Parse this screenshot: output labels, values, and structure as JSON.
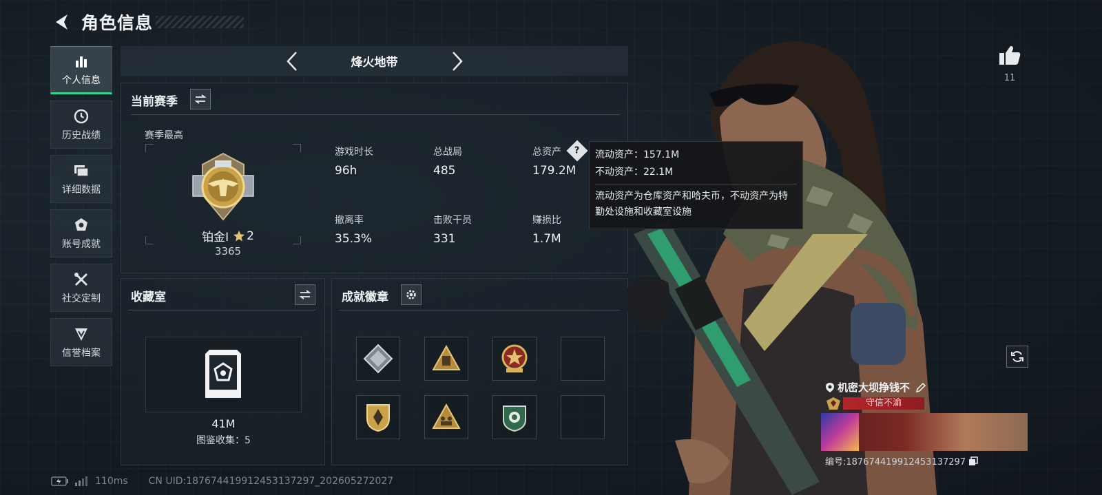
{
  "header": {
    "title": "角色信息"
  },
  "sidebar": {
    "items": [
      {
        "label": "个人信息",
        "icon": "bar-chart-icon",
        "active": true
      },
      {
        "label": "历史战绩",
        "icon": "history-icon"
      },
      {
        "label": "详细数据",
        "icon": "folder-icon"
      },
      {
        "label": "账号成就",
        "icon": "trophy-icon"
      },
      {
        "label": "社交定制",
        "icon": "tools-icon"
      },
      {
        "label": "信誉档案",
        "icon": "shield-icon"
      }
    ]
  },
  "mode": {
    "title": "烽火地带"
  },
  "season": {
    "title": "当前赛季",
    "best_label": "赛季最高",
    "rank_name": "铂金Ⅰ",
    "rank_stars": "2",
    "rank_points": "3365",
    "stats": [
      {
        "label": "游戏时长",
        "value": "96h"
      },
      {
        "label": "总战局",
        "value": "485"
      },
      {
        "label": "总资产",
        "value": "179.2M"
      },
      {
        "label": "撤离率",
        "value": "35.3%"
      },
      {
        "label": "击败干员",
        "value": "331"
      },
      {
        "label": "赚损比",
        "value": "1.7M"
      }
    ]
  },
  "tooltip": {
    "line1": "流动资产：157.1M",
    "line2": "不动资产：22.1M",
    "desc": "流动资产为仓库资产和哈夫币，不动资产为特勤处设施和收藏室设施"
  },
  "collection": {
    "title": "收藏室",
    "value": "41M",
    "count_text": "图鉴收集：5"
  },
  "badges": {
    "title": "成就徽章"
  },
  "likes": {
    "count": "11"
  },
  "player": {
    "name": "机密大坝挣钱不",
    "tag": "守信不渝",
    "id_text": "编号:187674419912453137297"
  },
  "footer": {
    "ping": "110ms",
    "uid": "CN UID:187674419912453137297_202605272027"
  },
  "colors": {
    "accent": "#2fd58f",
    "gold": "#c9a24a",
    "tag_red": "#b3262b"
  }
}
